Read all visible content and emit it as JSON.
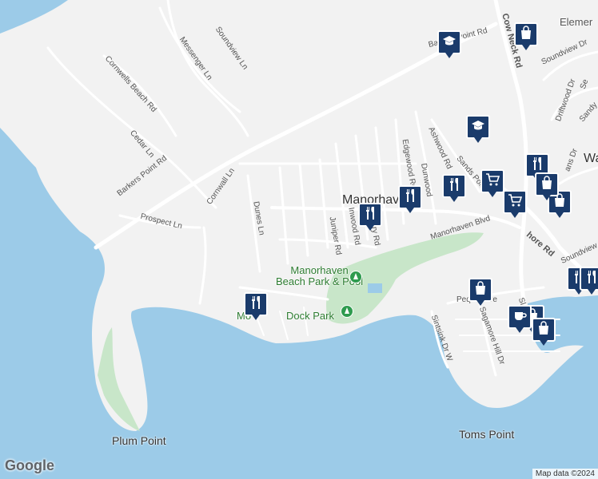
{
  "map": {
    "colors": {
      "water": "#9ccbe8",
      "land": "#f2f2f2",
      "park": "#c8e6c9",
      "road": "#ffffff",
      "pin": "#1a3b6b",
      "poi": "#2e9b4e"
    },
    "places": {
      "manorhaven": "Manorhaven",
      "beach_park": "Manorhaven\nBeach Park & Pool",
      "dock_park": "Dock Park",
      "dock_park_prefix": "Mo",
      "plum_point": "Plum Point",
      "toms_point": "Toms Point",
      "element": "Elemer",
      "wa": "Wa"
    },
    "roads": {
      "barkers_point_rd_1": "Barkers Point Rd",
      "barkers_point_rd_2": "Barkers Point Rd",
      "cow_neck_rd": "Cow Neck Rd",
      "soundview_ln": "Soundview Ln",
      "messenger_ln": "Messenger Ln",
      "cornwells_beach_rd": "Cornwells Beach Rd",
      "cedar_ln": "Cedar Ln",
      "cornwall_ln": "Cornwall Ln",
      "prospect_ln": "Prospect Ln",
      "dunes_ln": "Dunes Ln",
      "juniper_rd": "Juniper Rd",
      "inwood_rd": "Inwood Rd",
      "hickory_rd": "Hickory Rd",
      "edgewood_rd": "Edgewood Rd",
      "dunwood": "Dunwood",
      "ashwood_rd": "Ashwood Rd",
      "sands_point": "Sands Point",
      "manorhaven_blvd": "Manorhaven Blvd",
      "pequot_ave": "Pequot Ave",
      "sintsink_dr_w": "Sintsink Dr W",
      "sagamore_hill_dr": "Sagamore Hill Dr",
      "shore_rd": "hore Rd",
      "soundview_dr": "Soundview Dr",
      "soundview_dr_2": "Soundview",
      "driftwood_dr": "Driftwood Dr",
      "sandy": "Sandy",
      "se": "Se",
      "ans_dr": "ans Dr",
      "sl": "Sl"
    },
    "pins": [
      {
        "icon": "restaurant-icon"
      },
      {
        "icon": "restaurant-icon"
      },
      {
        "icon": "restaurant-icon"
      },
      {
        "icon": "restaurant-icon"
      },
      {
        "icon": "restaurant-icon"
      },
      {
        "icon": "restaurant-icon"
      },
      {
        "icon": "restaurant-icon"
      },
      {
        "icon": "shopping-bag-icon"
      },
      {
        "icon": "shopping-bag-icon"
      },
      {
        "icon": "shopping-bag-icon"
      },
      {
        "icon": "shopping-bag-icon"
      },
      {
        "icon": "shopping-bag-icon"
      },
      {
        "icon": "shopping-bag-icon"
      },
      {
        "icon": "school-icon"
      },
      {
        "icon": "school-icon"
      },
      {
        "icon": "cart-icon"
      },
      {
        "icon": "cart-icon"
      },
      {
        "icon": "cafe-icon"
      }
    ],
    "google_logo": "Google",
    "attribution": "Map data ©2024"
  }
}
